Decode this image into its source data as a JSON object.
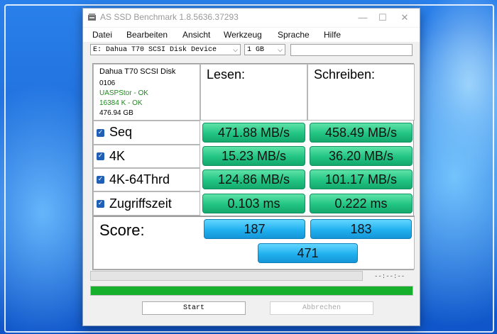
{
  "window": {
    "title": "AS SSD Benchmark 1.8.5636.37293",
    "minimize": "—",
    "maximize": "☐",
    "close": "✕"
  },
  "menu": [
    "Datei",
    "Bearbeiten",
    "Ansicht",
    "Werkzeug",
    "Sprache",
    "Hilfe"
  ],
  "selectors": {
    "drive": "E: Dahua T70 SCSI Disk Device",
    "size": "1 GB",
    "text_value": ""
  },
  "info": {
    "name": "Dahua T70 SCSI Disk",
    "firmware": "0106",
    "driver_status": "UASPStor - OK",
    "alignment_status": "16384 K - OK",
    "capacity": "476.94 GB"
  },
  "columns": {
    "read": "Lesen:",
    "write": "Schreiben:"
  },
  "tests": [
    {
      "label": "Seq",
      "checked": true,
      "read": "471.88 MB/s",
      "write": "458.49 MB/s"
    },
    {
      "label": "4K",
      "checked": true,
      "read": "15.23 MB/s",
      "write": "36.20 MB/s"
    },
    {
      "label": "4K-64Thrd",
      "checked": true,
      "read": "124.86 MB/s",
      "write": "101.17 MB/s"
    },
    {
      "label": "Zugriffszeit",
      "checked": true,
      "read": "0.103 ms",
      "write": "0.222 ms"
    }
  ],
  "score": {
    "label": "Score:",
    "read": "187",
    "write": "183",
    "total": "471"
  },
  "progress": {
    "elapsed": "--:--:--",
    "bar_fraction": 0,
    "complete_fraction": 1.0
  },
  "buttons": {
    "start": "Start",
    "cancel": "Abbrechen"
  },
  "colors": {
    "result_green": "#22c483",
    "score_blue": "#21b0ef",
    "progress_green": "#16b02c",
    "ok_text": "#1c8a1c"
  }
}
